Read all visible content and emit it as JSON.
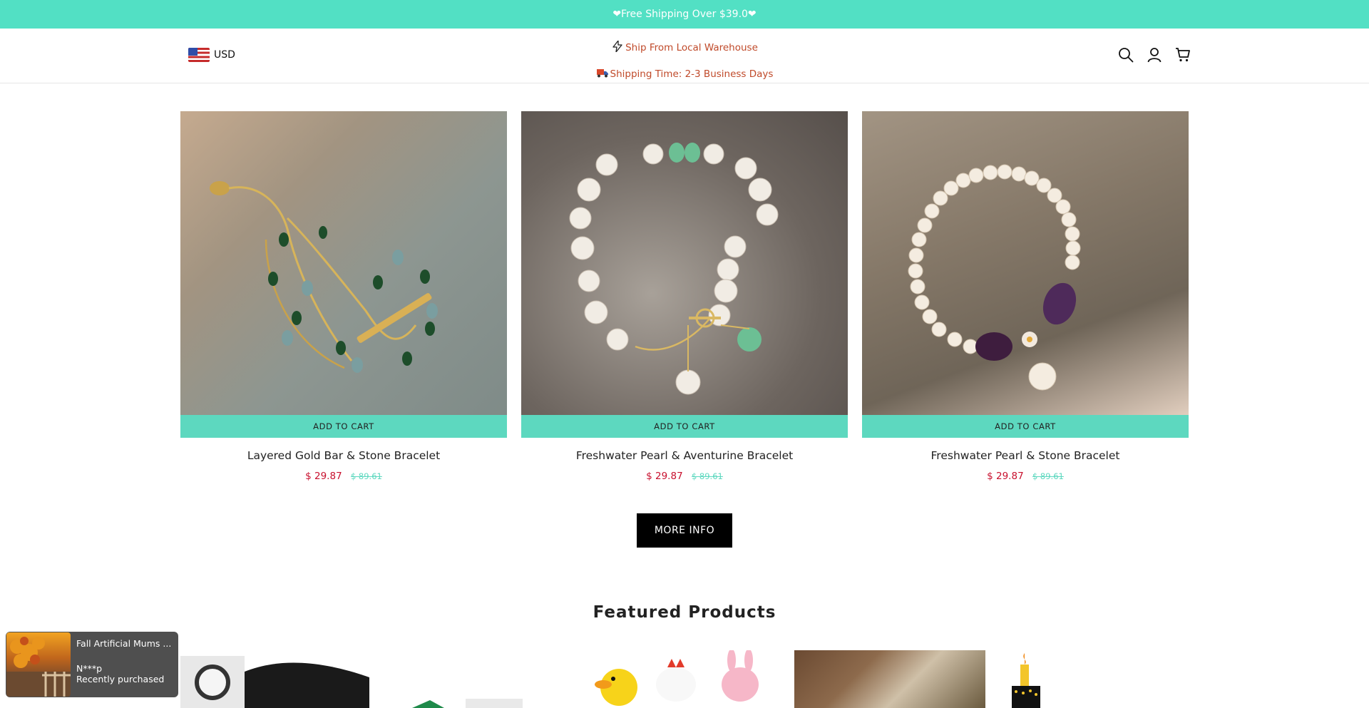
{
  "announcement": {
    "text": "❤Free Shipping Over $39.0❤"
  },
  "header": {
    "currency": "USD",
    "notices": [
      {
        "icon": "lightning-icon",
        "text": "Ship From Local Warehouse"
      },
      {
        "icon": "truck-icon",
        "text": "Shipping Time: 2-3 Business Days"
      }
    ],
    "icons": [
      "search-icon",
      "account-icon",
      "cart-icon"
    ]
  },
  "products": [
    {
      "title": "Layered Gold Bar & Stone Bracelet",
      "cart_label": "ADD TO CART",
      "price": "$ 29.87",
      "compare_price": "$ 89.61"
    },
    {
      "title": "Freshwater Pearl & Aventurine Bracelet",
      "cart_label": "ADD TO CART",
      "price": "$ 29.87",
      "compare_price": "$ 89.61"
    },
    {
      "title": "Freshwater Pearl & Stone Bracelet",
      "cart_label": "ADD TO CART",
      "price": "$ 29.87",
      "compare_price": "$ 89.61"
    }
  ],
  "more_info": "MORE INFO",
  "featured": {
    "title": "Featured Products"
  },
  "toast": {
    "product": "Fall Artificial Mums ...",
    "buyer": "N***p",
    "status": "Recently purchased"
  },
  "colors": {
    "accent": "#52e0c4",
    "price": "#c8102e",
    "notice": "#c04a2a"
  }
}
